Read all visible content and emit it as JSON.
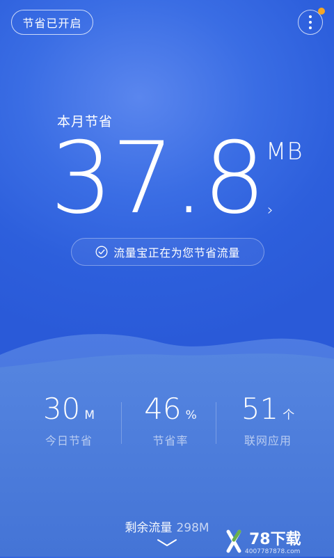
{
  "top": {
    "save_toggle": "节省已开启"
  },
  "hero": {
    "month_label": "本月节省",
    "amount": "37.8",
    "unit": "MB",
    "status": "流量宝正在为您节省流量"
  },
  "stats": [
    {
      "value": "30",
      "unit": "M",
      "label": "今日节省"
    },
    {
      "value": "46",
      "unit": "%",
      "label": "节省率"
    },
    {
      "value": "51",
      "unit": "个",
      "label": "联网应用"
    }
  ],
  "remaining": {
    "label": "剩余流量",
    "value": "298M"
  },
  "watermark": {
    "brand": "78下载",
    "phone": "4007787878.com"
  },
  "colors": {
    "notify_dot": "#f5a623",
    "wave_light": "#5f8fe6",
    "wave_bottom": "#4a7ad9"
  }
}
